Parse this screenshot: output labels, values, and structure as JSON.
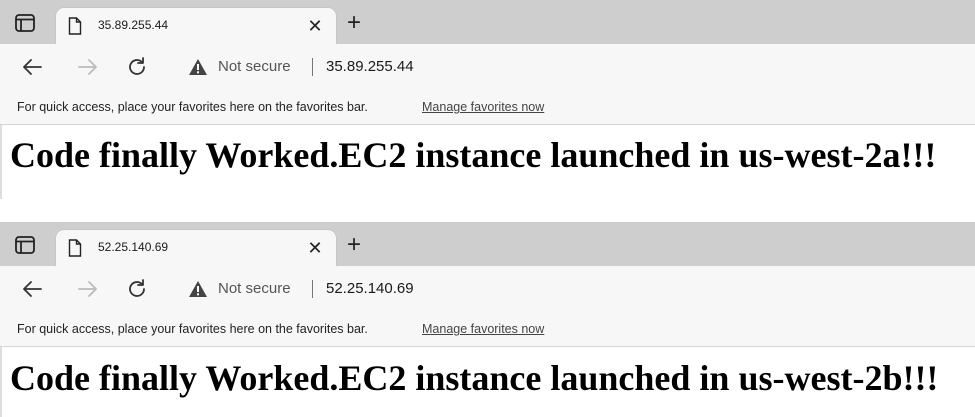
{
  "windows": [
    {
      "tab": {
        "title": "35.89.255.44",
        "close_icon": "close-icon"
      },
      "address": {
        "security_text": "Not secure",
        "url": "35.89.255.44"
      },
      "favorites_bar": {
        "message": "For quick access, place your favorites here on the favorites bar.",
        "link": "Manage favorites now"
      },
      "page": {
        "headline": "Code finally Worked.EC2 instance launched in us-west-2a!!!"
      }
    },
    {
      "tab": {
        "title": "52.25.140.69",
        "close_icon": "close-icon"
      },
      "address": {
        "security_text": "Not secure",
        "url": "52.25.140.69"
      },
      "favorites_bar": {
        "message": "For quick access, place your favorites here on the favorites bar.",
        "link": "Manage favorites now"
      },
      "page": {
        "headline": "Code finally Worked.EC2 instance launched in us-west-2b!!!"
      }
    }
  ],
  "icons": [
    "tab-actions-icon",
    "page-icon",
    "close-icon",
    "new-tab-icon",
    "back-icon",
    "forward-icon",
    "reload-icon",
    "warning-icon"
  ],
  "colors": {
    "tabstrip": "#cecece",
    "toolbar": "#f7f7f7",
    "link": "#444444"
  }
}
